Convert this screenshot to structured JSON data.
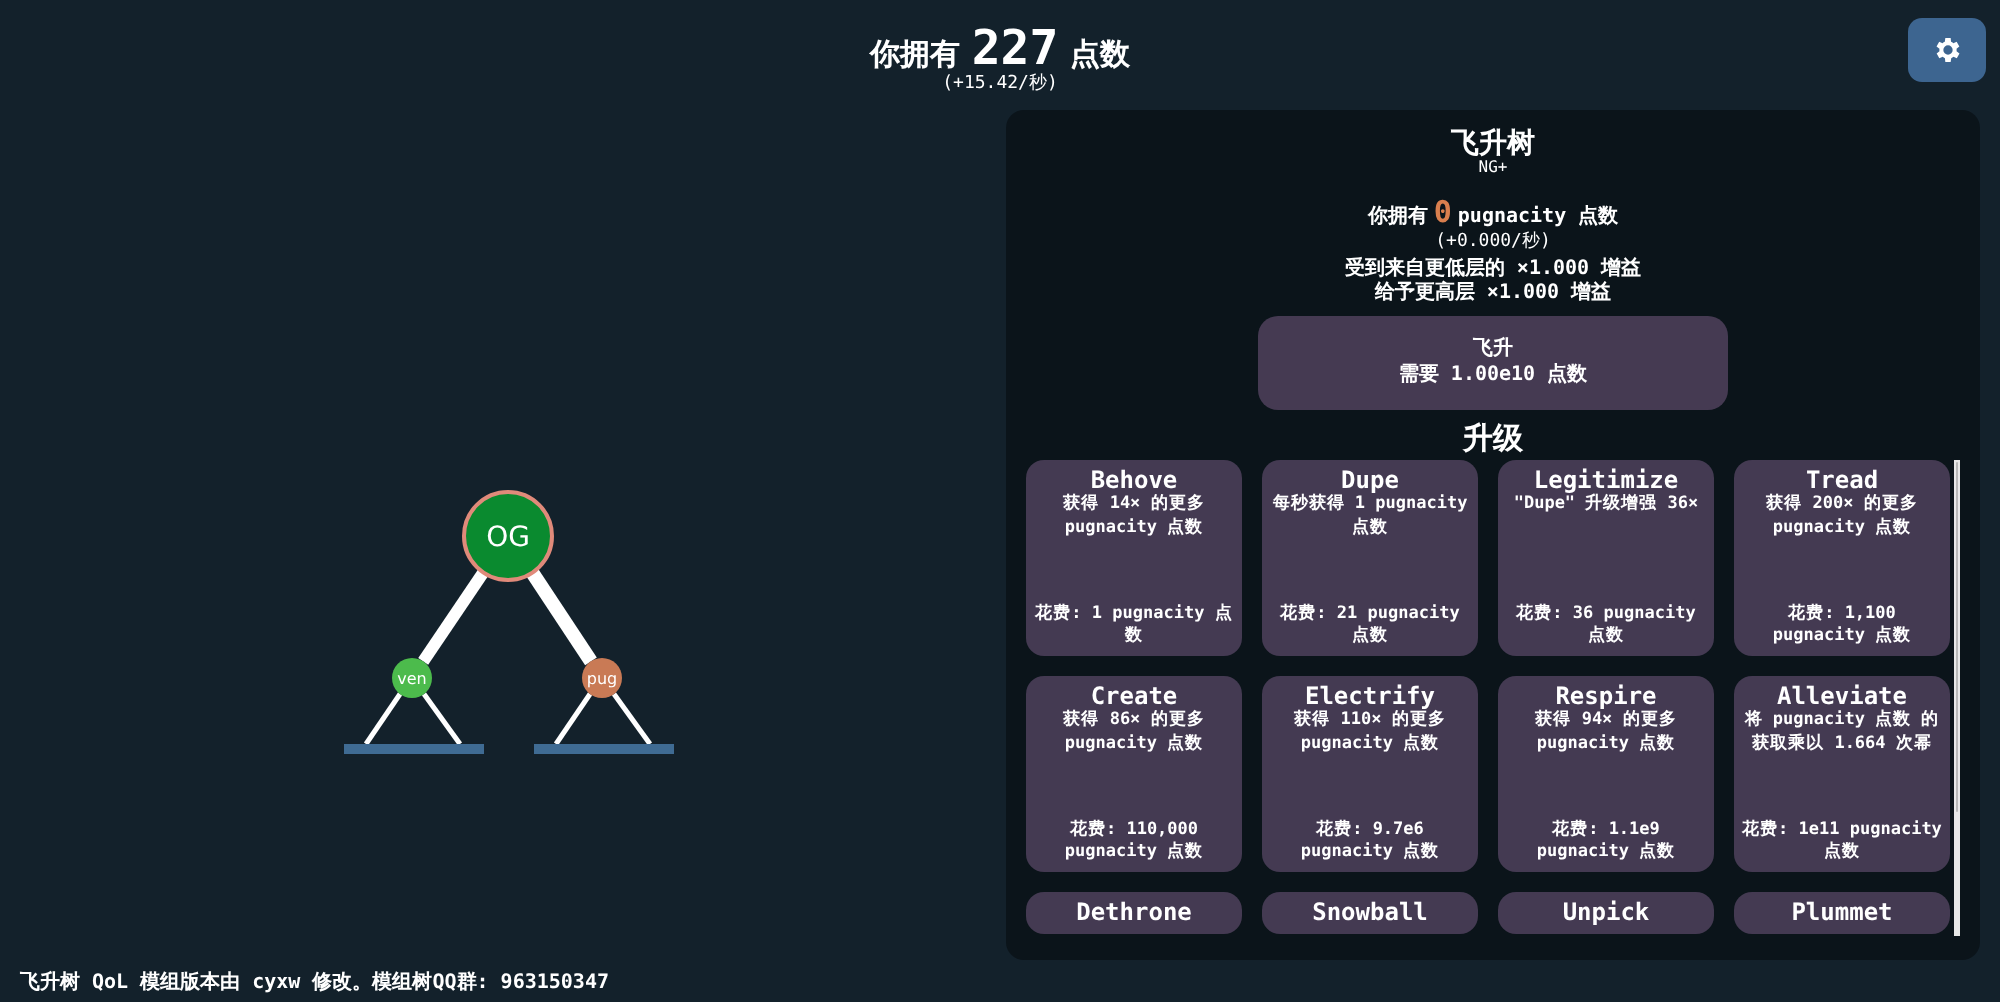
{
  "header": {
    "prefix": "你拥有",
    "points": "227",
    "suffix": "点数",
    "rate": "(+15.42/秒)"
  },
  "tree": {
    "root": {
      "label": "OG",
      "color": "#0a8a2f",
      "glow": true,
      "children": [
        {
          "label": "ven",
          "color": "#4cbb4c"
        },
        {
          "label": "pug",
          "color": "#c97a55"
        }
      ]
    }
  },
  "panel": {
    "title": "飞升树",
    "subtitle": "NG+",
    "have_prefix": "你拥有",
    "amount": "0",
    "have_suffix": "pugnacity 点数",
    "rate": "(+0.000/秒)",
    "boost_lines": [
      "受到来自更低层的 ×1.000 增益",
      "给予更高层 ×1.000 增益"
    ],
    "prestige_button": {
      "title": "飞升",
      "requirement": "需要 1.00e10 点数"
    },
    "upgrades_title": "升级",
    "upgrades": [
      {
        "title": "Behove",
        "description": "获得 14× 的更多 pugnacity 点数",
        "cost": "花费: 1 pugnacity 点数"
      },
      {
        "title": "Dupe",
        "description": "每秒获得 1 pugnacity 点数",
        "cost": "花费: 21 pugnacity 点数"
      },
      {
        "title": "Legitimize",
        "description": "\"Dupe\" 升级增强 36×",
        "cost": "花费: 36 pugnacity 点数"
      },
      {
        "title": "Tread",
        "description": "获得 200× 的更多 pugnacity 点数",
        "cost": "花费: 1,100 pugnacity 点数"
      },
      {
        "title": "Create",
        "description": "获得 86× 的更多 pugnacity 点数",
        "cost": "花费: 110,000 pugnacity 点数"
      },
      {
        "title": "Electrify",
        "description": "获得 110× 的更多 pugnacity 点数",
        "cost": "花费: 9.7e6 pugnacity 点数"
      },
      {
        "title": "Respire",
        "description": "获得 94× 的更多 pugnacity 点数",
        "cost": "花费: 1.1e9 pugnacity 点数"
      },
      {
        "title": "Alleviate",
        "description": "将 pugnacity 点数 的获取乘以 1.664 次幂",
        "cost": "花费: 1e11 pugnacity 点数"
      },
      {
        "title": "Dethrone"
      },
      {
        "title": "Snowball"
      },
      {
        "title": "Unpick"
      },
      {
        "title": "Plummet"
      }
    ]
  },
  "footer": "飞升树 QoL 模组版本由 cyxw 修改。模组树QQ群: 963150347"
}
